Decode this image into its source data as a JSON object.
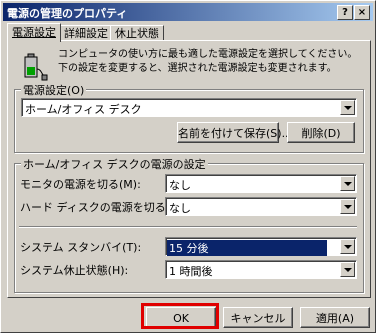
{
  "window": {
    "title": "電源の管理のプロパティ",
    "help_glyph": "?",
    "close_glyph": "×"
  },
  "tabs": [
    {
      "label": "電源設定",
      "active": true
    },
    {
      "label": "詳細設定",
      "active": false
    },
    {
      "label": "休止状態",
      "active": false
    }
  ],
  "description": "コンピュータの使い方に最も適した電源設定を選択してください。下の設定を変更すると、選択された電源設定も変更されます。",
  "power_scheme": {
    "group_label": "電源設定(O)",
    "selected": "ホーム/オフィス デスク",
    "save_as_button": "名前を付けて保存(S)...",
    "delete_button": "削除(D)"
  },
  "scheme_settings": {
    "group_label": "ホーム/オフィス デスクの電源の設定",
    "monitor_label": "モニタの電源を切る(M):",
    "monitor_value": "なし",
    "harddisk_label": "ハード ディスクの電源を切る(I):",
    "harddisk_value": "なし",
    "standby_label": "システム スタンバイ(T):",
    "standby_value": "15 分後",
    "hibernate_label": "システム休止状態(H):",
    "hibernate_value": "1 時間後"
  },
  "footer": {
    "ok_button": "OK",
    "cancel_button": "キャンセル",
    "apply_button": "適用(A)"
  },
  "icons": [
    "battery-plug-icon",
    "help-icon",
    "close-icon",
    "dropdown-arrow-icon"
  ],
  "colors": {
    "titlebar_start": "#0a246a",
    "titlebar_end": "#a6caf0",
    "highlight": "#0a246a",
    "ok_outline": "#e00000"
  }
}
